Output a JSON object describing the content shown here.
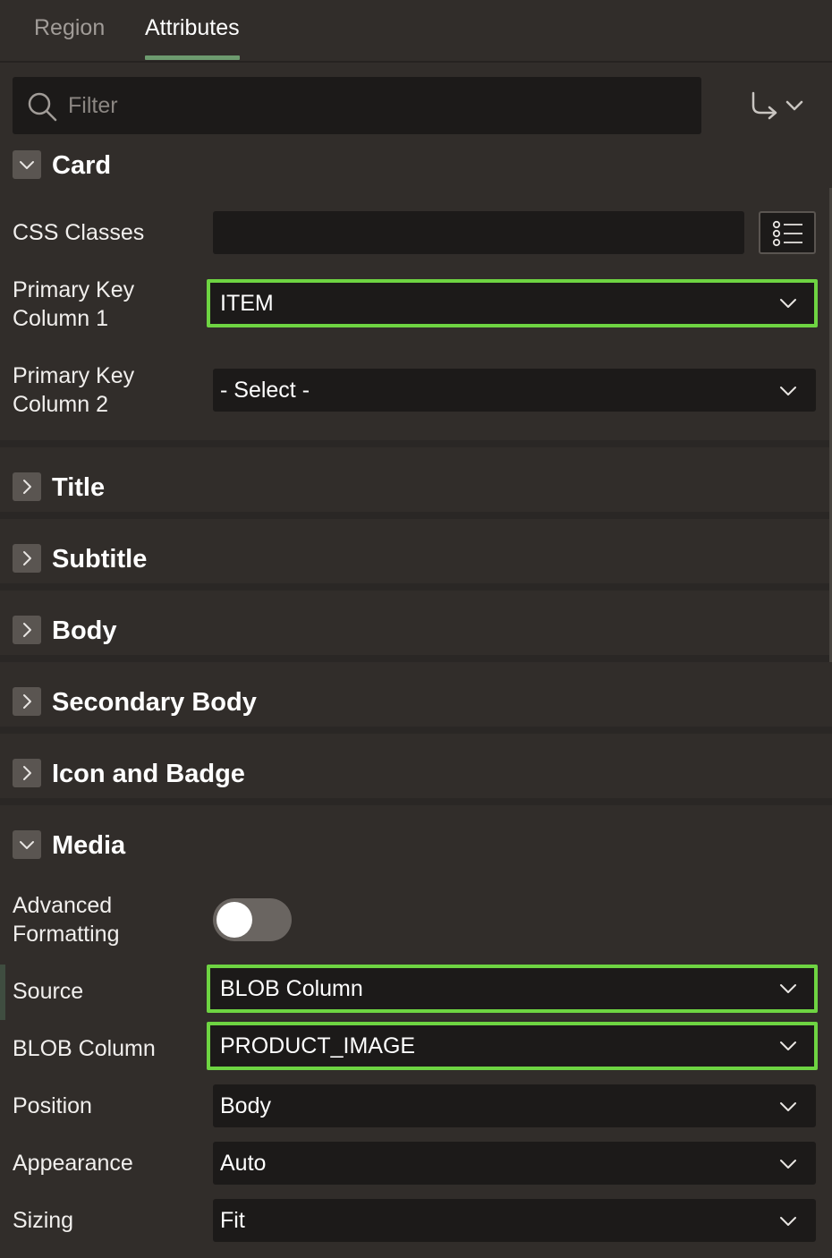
{
  "tabs": [
    {
      "label": "Region",
      "active": false
    },
    {
      "label": "Attributes",
      "active": true
    }
  ],
  "filter": {
    "placeholder": "Filter",
    "value": ""
  },
  "sections": {
    "card": {
      "title": "Card",
      "expanded": true
    },
    "title": {
      "title": "Title",
      "expanded": false
    },
    "subtitle": {
      "title": "Subtitle",
      "expanded": false
    },
    "body": {
      "title": "Body",
      "expanded": false
    },
    "secondary_body": {
      "title": "Secondary Body",
      "expanded": false
    },
    "icon_badge": {
      "title": "Icon and Badge",
      "expanded": false
    },
    "media": {
      "title": "Media",
      "expanded": true
    }
  },
  "card": {
    "css_classes": {
      "label": "CSS Classes",
      "value": ""
    },
    "pk1": {
      "label_line1": "Primary Key",
      "label_line2": "Column 1",
      "value": "ITEM"
    },
    "pk2": {
      "label_line1": "Primary Key",
      "label_line2": "Column 2",
      "value": "- Select -"
    }
  },
  "media": {
    "advanced_formatting": {
      "label_line1": "Advanced",
      "label_line2": "Formatting",
      "on": false
    },
    "source": {
      "label": "Source",
      "value": "BLOB Column"
    },
    "blob_column": {
      "label": "BLOB Column",
      "value": "PRODUCT_IMAGE"
    },
    "position": {
      "label": "Position",
      "value": "Body"
    },
    "appearance": {
      "label": "Appearance",
      "value": "Auto"
    },
    "sizing": {
      "label": "Sizing",
      "value": "Fit"
    }
  },
  "colors": {
    "background": "#312d2a",
    "field_background": "#1c1a19",
    "highlight_border": "#6ed442",
    "tab_underline": "#6d9b6f"
  },
  "icons": {
    "search": "search-icon",
    "goto": "go-to-group-icon",
    "expand": "chevron-right-icon",
    "collapse": "chevron-down-icon",
    "list": "list-icon",
    "dropdown": "chevron-down-icon"
  }
}
